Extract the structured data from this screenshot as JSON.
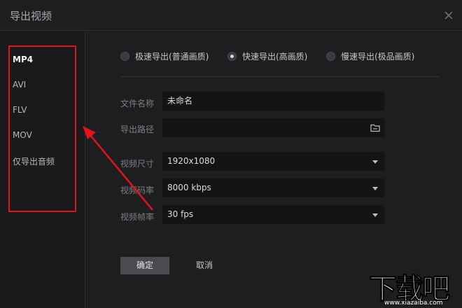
{
  "window": {
    "title": "导出视频",
    "close_icon": "close-icon"
  },
  "sidebar": {
    "formats": [
      {
        "label": "MP4",
        "active": true
      },
      {
        "label": "AVI",
        "active": false
      },
      {
        "label": "FLV",
        "active": false
      },
      {
        "label": "MOV",
        "active": false
      },
      {
        "label": "仅导出音频",
        "active": false
      }
    ]
  },
  "export_mode": {
    "options": [
      {
        "label": "极速导出(普通画质)",
        "checked": false
      },
      {
        "label": "快速导出(高画质)",
        "checked": true
      },
      {
        "label": "慢速导出(极品画质)",
        "checked": false
      }
    ]
  },
  "form": {
    "filename": {
      "label": "文件名称",
      "value": "未命名"
    },
    "path": {
      "label": "导出路径",
      "value": "",
      "icon": "folder-icon"
    },
    "resolution": {
      "label": "视频尺寸",
      "value": "1920x1080"
    },
    "bitrate": {
      "label": "视频码率",
      "value": "8000 kbps"
    },
    "framerate": {
      "label": "视频帧率",
      "value": "30 fps"
    }
  },
  "actions": {
    "ok_label": "确定",
    "cancel_label": "取消"
  },
  "watermark": {
    "text": "下载吧",
    "url": "www.xiazaiba.com"
  },
  "colors": {
    "highlight": "#e0141c",
    "background": "#1e1e20",
    "field": "#141416"
  }
}
